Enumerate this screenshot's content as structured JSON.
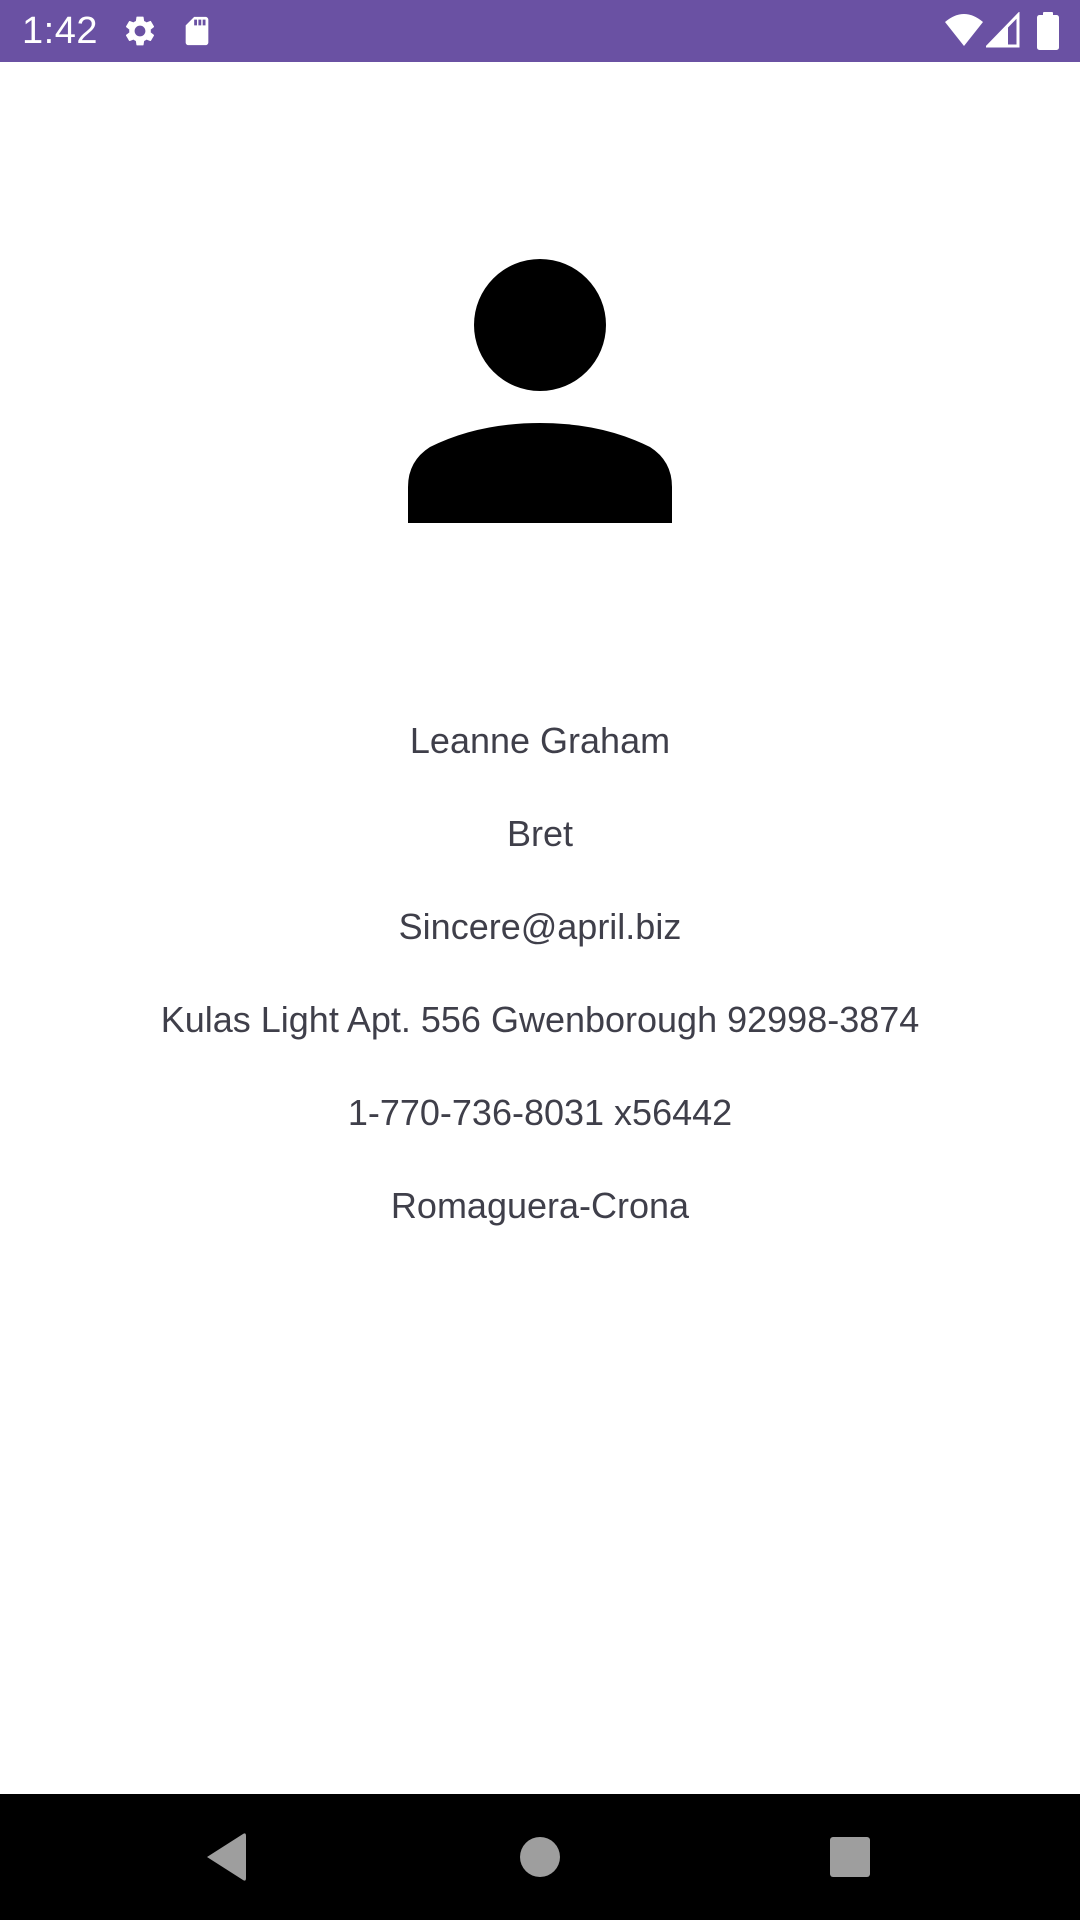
{
  "status_bar": {
    "time": "1:42",
    "background_color": "#6a51a3",
    "left_icons": [
      "gear-icon",
      "sd-card-icon"
    ],
    "right_icons": [
      "wifi-icon",
      "cell-signal-icon",
      "battery-icon"
    ]
  },
  "profile": {
    "avatar_icon": "person-icon",
    "name": "Leanne Graham",
    "username": "Bret",
    "email": "Sincere@april.biz",
    "address": "Kulas Light Apt. 556 Gwenborough 92998-3874",
    "phone": "1-770-736-8031 x56442",
    "company": "Romaguera-Crona",
    "text_color": "#3f3f4a"
  },
  "nav_bar": {
    "buttons": [
      "back-icon",
      "home-icon",
      "recents-icon"
    ],
    "icon_color": "#9e9e9e"
  }
}
